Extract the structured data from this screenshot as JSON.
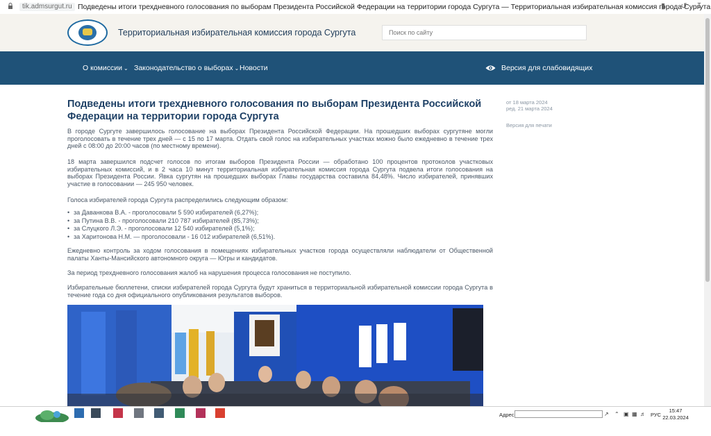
{
  "browser": {
    "domain": "tik.admsurgut.ru",
    "tab_title": "Подведены итоги трехдневного голосования по выборам Президента Российской Федерации на территории города Сургута — Территориальная избирательная комиссия города Сургута"
  },
  "header": {
    "site_title": "Территориальная избирательная комиссия города Сургута",
    "search_placeholder": "Поиск по сайту"
  },
  "nav": {
    "items": [
      {
        "label": "О комиссии",
        "dropdown": true
      },
      {
        "label": "Законодательство о выборах",
        "dropdown": true
      },
      {
        "label": "Новости",
        "dropdown": false
      }
    ],
    "accessibility_label": "Версия для слабовидящих"
  },
  "article": {
    "title": "Подведены итоги трехдневного голосования по выборам Президента Российской Федерации на территории города Сургута",
    "date_from": "от 18 марта 2024",
    "date_edit": "ред.  21 марта 2024",
    "print_label": "Версия для печати",
    "paragraphs": [
      "В городе Сургуте завершилось голосование на выборах Президента Российской Федерации. На прошедших выборах сургутяне могли проголосовать в течение трех дней —  с 15 по 17 марта. Отдать свой голос на избирательных участках можно было ежедневно в течение трех дней с 08:00 до 20:00 часов (по местному времени).",
      "18 марта завершился подсчет голосов по итогам выборов Президента России — обработано 100 процентов протоколов участковых избирательных комиссий, и в 2 часа 10 минут территориальная избирательная комиссия города Сургута подвела итоги голосования на выборах Президента  России. Явка сургутян на прошедших выборах Главы государства составила 84,48%. Число избирателей, принявших участие в голосовании —  245 950 человек.",
      " Голоса избирателей города Сургута распределились следующим образом:",
      "Ежедневно контроль за ходом голосования в помещениях избирательных участков  города осуществляли  наблюдатели от Общественной палаты Ханты-Мансийского автономного округа — Югры и кандидатов.",
      "За период трехдневного голосования жалоб на нарушения процесса голосования не поступило.",
      "Избирательные бюллетени, списки избирателей города Сургута будут храниться в территориальной избирательной комиссии города Сургута в течение года со дня официального опубликования результатов выборов."
    ],
    "results": [
      "за Даванкова В.А. - проголосовали 5 590  избирателей (6,27%);",
      "за Путина В.В. - проголосовали  210 787 избирателей (85,73%);",
      "за  Слуцкого Л.Э. -  проголосовали 12 540  избирателей (5,1%);",
      "за  Харитонова  Н.М. — проголосовали - 16 012 избирателей (6,51%)."
    ]
  },
  "taskbar": {
    "address_label": "Адрес",
    "lang": "РУС",
    "time": "15:47",
    "date": "22.03.2024"
  }
}
